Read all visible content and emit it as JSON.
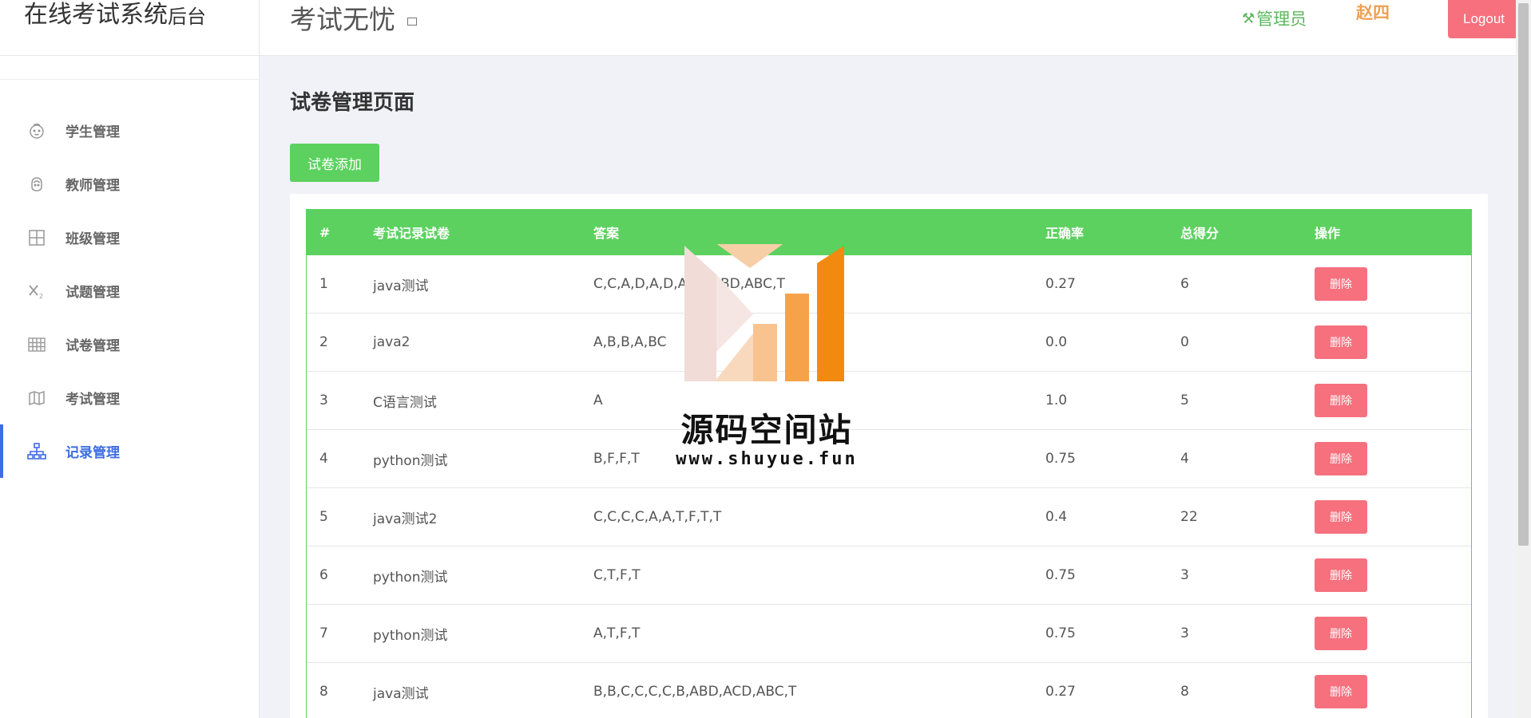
{
  "sidebar": {
    "brand_main": "在线考试系统",
    "brand_sub": "后台",
    "items": [
      {
        "label": "学生管理",
        "icon": "face-icon"
      },
      {
        "label": "教师管理",
        "icon": "teacher-icon"
      },
      {
        "label": "班级管理",
        "icon": "grid-icon"
      },
      {
        "label": "试题管理",
        "icon": "subscript-icon"
      },
      {
        "label": "试卷管理",
        "icon": "table-icon"
      },
      {
        "label": "考试管理",
        "icon": "map-icon"
      },
      {
        "label": "记录管理",
        "icon": "sitemap-icon",
        "active": true
      }
    ]
  },
  "header": {
    "app_title": "考试无忧",
    "role": "管理员",
    "username": "赵四",
    "logout_label": "Logout"
  },
  "main": {
    "page_title": "试卷管理页面",
    "add_label": "试卷添加",
    "columns": [
      "#",
      "考试记录试卷",
      "答案",
      "正确率",
      "总得分",
      "操作"
    ],
    "rows": [
      {
        "num": "1",
        "name": "java测试",
        "answer": "C,C,A,D,A,D,ABD,ABD,ABC,T",
        "rate": "0.27",
        "score": "6",
        "action": "删除"
      },
      {
        "num": "2",
        "name": "java2",
        "answer": "A,B,B,A,BC",
        "rate": "0.0",
        "score": "0",
        "action": "删除"
      },
      {
        "num": "3",
        "name": "C语言测试",
        "answer": "A",
        "rate": "1.0",
        "score": "5",
        "action": "删除"
      },
      {
        "num": "4",
        "name": "python测试",
        "answer": "B,F,F,T",
        "rate": "0.75",
        "score": "4",
        "action": "删除"
      },
      {
        "num": "5",
        "name": "java测试2",
        "answer": "C,C,C,C,A,A,T,F,T,T",
        "rate": "0.4",
        "score": "22",
        "action": "删除"
      },
      {
        "num": "6",
        "name": "python测试",
        "answer": "C,T,F,T",
        "rate": "0.75",
        "score": "3",
        "action": "删除"
      },
      {
        "num": "7",
        "name": "python测试",
        "answer": "A,T,F,T",
        "rate": "0.75",
        "score": "3",
        "action": "删除"
      },
      {
        "num": "8",
        "name": "java测试",
        "answer": "B,B,C,C,C,C,B,ABD,ACD,ABC,T",
        "rate": "0.27",
        "score": "8",
        "action": "删除"
      }
    ]
  },
  "watermark": {
    "text": "源码空间站",
    "url": "www.shuyue.fun"
  },
  "colors": {
    "accent_green": "#5cd15f",
    "danger": "#f6707e",
    "active_blue": "#3d6de0",
    "username_orange": "#f0a050"
  }
}
